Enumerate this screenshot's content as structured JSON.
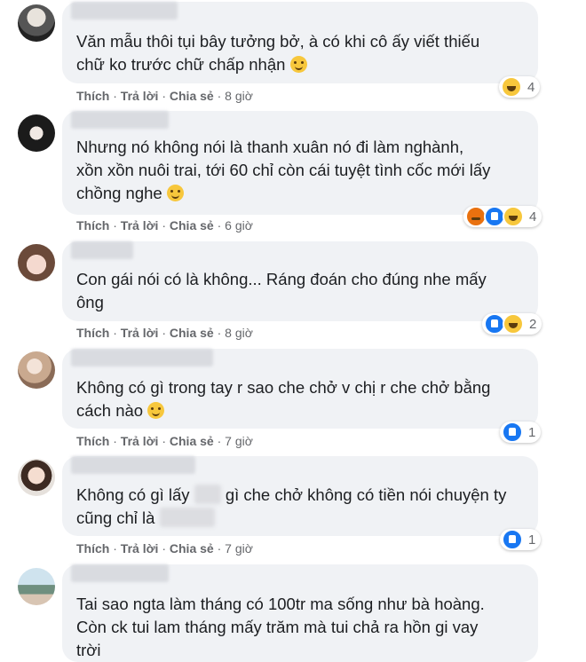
{
  "action_labels": {
    "like": "Thích",
    "reply": "Trả lời",
    "share": "Chia sẻ",
    "sep": "·"
  },
  "comments": [
    {
      "line1": "Văn mẫu thôi tụi bây tưởng bở, à có khi cô ấy viết thiếu",
      "line2": "chữ ko trước chữ chấp nhận",
      "time": "8 giờ",
      "reaction_count": "4",
      "reactions": [
        "haha-icon"
      ]
    },
    {
      "line1": "Nhưng nó không nói là thanh xuân nó đi làm nghành,",
      "line2": "xồn xồn nuôi trai, tới 60 chỉ còn cái tuyệt tình cốc mới lấy",
      "line3": "chồng nghe",
      "time": "6 giờ",
      "reaction_count": "4",
      "reactions": [
        "angry-icon",
        "like-icon",
        "haha-icon"
      ]
    },
    {
      "line1": "Con gái nói có là không... Ráng đoán cho đúng nhe mấy",
      "line2": "ông",
      "time": "8 giờ",
      "reaction_count": "2",
      "reactions": [
        "like-icon",
        "haha-icon"
      ]
    },
    {
      "line1": "Không có gì trong tay r sao che chở v chị r che chở bằng",
      "line2": "cách nào",
      "time": "7 giờ",
      "reaction_count": "1",
      "reactions": [
        "like-icon"
      ]
    },
    {
      "line1a": "Không có gì lấy",
      "line1b": "gì che chở không có tiền nói chuyện ty",
      "line2": "cũng chỉ là",
      "time": "7 giờ",
      "reaction_count": "1",
      "reactions": [
        "like-icon"
      ]
    },
    {
      "line1": "Tai sao ngta làm tháng có 100tr ma sống như bà hoàng.",
      "line2": "Còn ck tui lam tháng mấy trăm mà tui chả ra hồn gi vay",
      "line3": "trời"
    }
  ]
}
